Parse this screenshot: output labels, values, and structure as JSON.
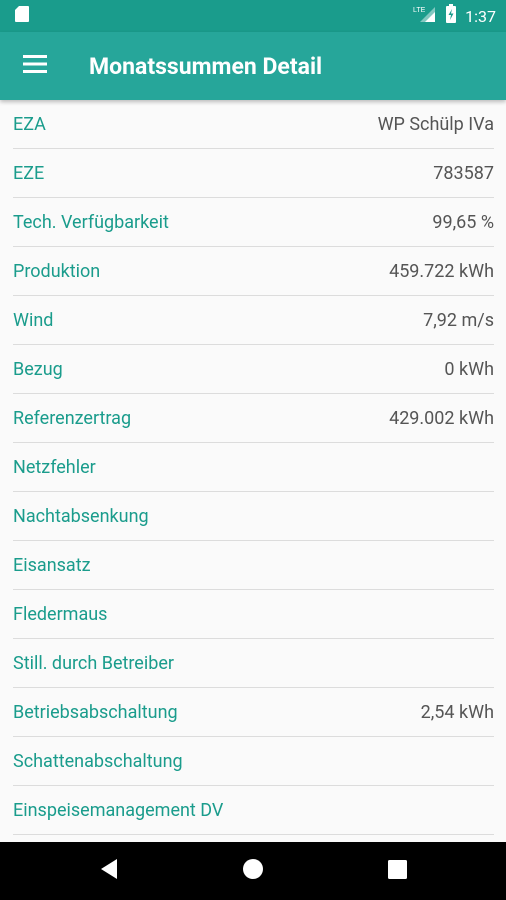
{
  "status_bar": {
    "time": "1:37",
    "network_label": "LTE"
  },
  "app_bar": {
    "title": "Monatssummen Detail"
  },
  "rows": [
    {
      "label": "EZA",
      "value": "WP Schülp IVa"
    },
    {
      "label": "EZE",
      "value": "783587"
    },
    {
      "label": "Tech. Verfügbarkeit",
      "value": "99,65 %"
    },
    {
      "label": "Produktion",
      "value": "459.722 kWh"
    },
    {
      "label": "Wind",
      "value": "7,92 m/s"
    },
    {
      "label": "Bezug",
      "value": "0 kWh"
    },
    {
      "label": "Referenzertrag",
      "value": "429.002 kWh"
    },
    {
      "label": "Netzfehler",
      "value": ""
    },
    {
      "label": "Nachtabsenkung",
      "value": ""
    },
    {
      "label": "Eisansatz",
      "value": ""
    },
    {
      "label": "Fledermaus",
      "value": ""
    },
    {
      "label": "Still. durch Betreiber",
      "value": ""
    },
    {
      "label": "Betriebsabschaltung",
      "value": "2,54 kWh"
    },
    {
      "label": "Schattenabschaltung",
      "value": ""
    },
    {
      "label": "Einspeisemanagement DV",
      "value": ""
    },
    {
      "label": "",
      "value": ""
    }
  ],
  "colors": {
    "primary": "#26a69a",
    "primary_dark": "#1a9c8c",
    "label_text": "#1a9c8c",
    "value_text": "#555555"
  }
}
